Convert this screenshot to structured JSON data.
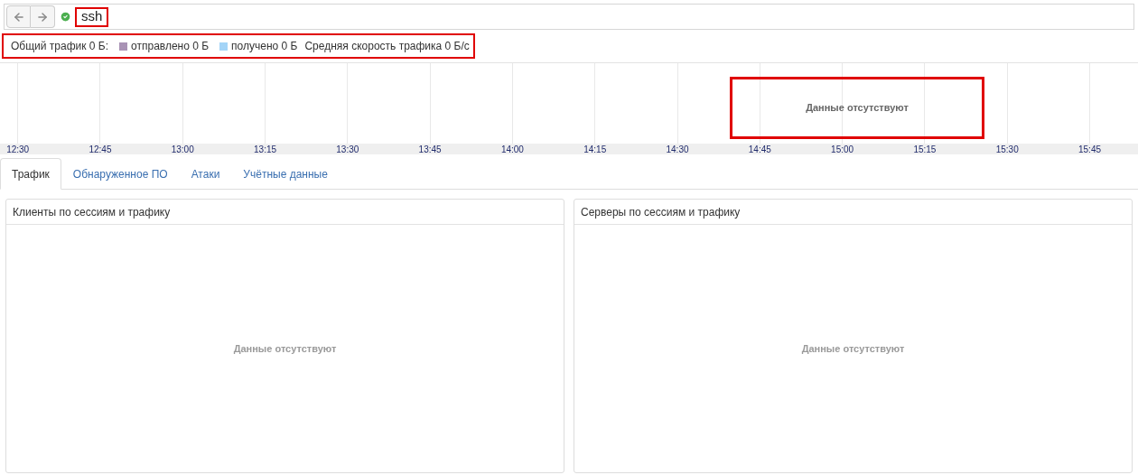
{
  "toolbar": {
    "search_value": "ssh",
    "status_ok": true,
    "highlighted": true
  },
  "stats": {
    "highlighted": true,
    "items": [
      {
        "kind": "text",
        "label": "Общий трафик 0 Б:"
      },
      {
        "kind": "legend",
        "label": "отправлено 0 Б",
        "color": "#a993b5"
      },
      {
        "kind": "legend",
        "label": "получено 0 Б",
        "color": "#a3d4f7"
      },
      {
        "kind": "text",
        "label": "Средняя скорость трафика 0 Б/с"
      }
    ]
  },
  "timeline": {
    "message": "Данные отсутствуют",
    "message_highlighted": true,
    "ticks": [
      "12:30",
      "12:45",
      "13:00",
      "13:15",
      "13:30",
      "13:45",
      "14:00",
      "14:15",
      "14:30",
      "14:45",
      "15:00",
      "15:15",
      "15:30",
      "15:45"
    ]
  },
  "tabs": [
    {
      "label": "Трафик",
      "selected": true
    },
    {
      "label": "Обнаруженное ПО",
      "selected": false
    },
    {
      "label": "Атаки",
      "selected": false
    },
    {
      "label": "Учётные данные",
      "selected": false
    }
  ],
  "panels": [
    {
      "title": "Клиенты по сессиям и трафику",
      "message": "Данные отсутствуют"
    },
    {
      "title": "Серверы по сессиям и трафику",
      "message": "Данные отсутствуют"
    }
  ]
}
